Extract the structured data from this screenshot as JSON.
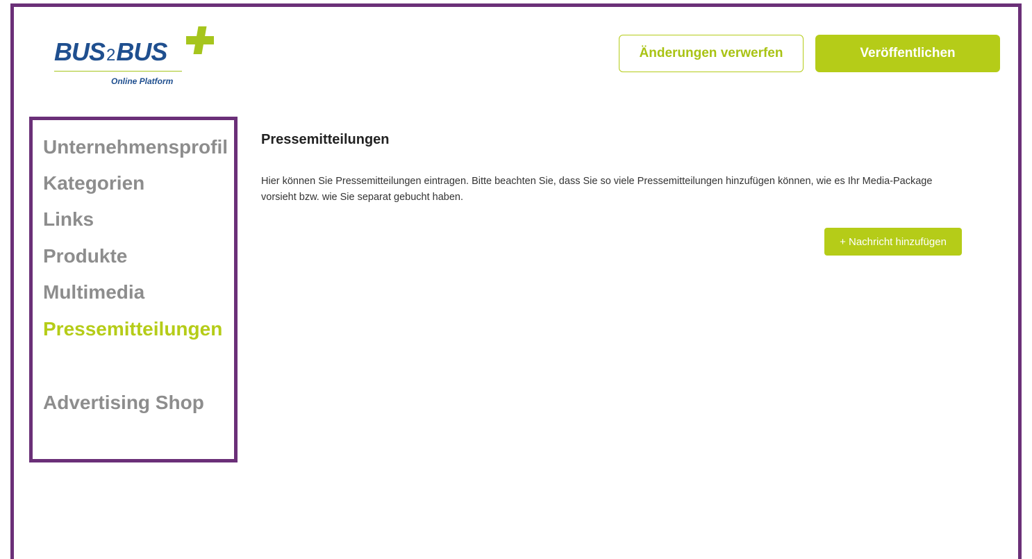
{
  "logo": {
    "brand_left": "BUS",
    "brand_mid": "2",
    "brand_right": "BUS",
    "subtitle": "Online Platform"
  },
  "header": {
    "discard_label": "Änderungen verwerfen",
    "publish_label": "Veröffentlichen"
  },
  "sidebar": {
    "items": [
      {
        "label": "Unternehmensprofil"
      },
      {
        "label": "Kategorien"
      },
      {
        "label": "Links"
      },
      {
        "label": "Produkte"
      },
      {
        "label": "Multimedia"
      },
      {
        "label": "Pressemitteilungen"
      },
      {
        "label": "Advertising Shop"
      }
    ],
    "active_index": 5
  },
  "main": {
    "title": "Pressemitteilungen",
    "description": "Hier können Sie Pressemitteilungen eintragen. Bitte beachten Sie, dass Sie so viele Pressemitteilungen hinzufügen können, wie es Ihr Media-Package vorsieht bzw. wie Sie separat gebucht haben.",
    "add_button_label": "+ Nachricht hinzufügen"
  },
  "colors": {
    "accent": "#b5cc18",
    "frame": "#6b3078",
    "brand_blue": "#1f4f8f",
    "nav_inactive": "#8d8d8d"
  }
}
